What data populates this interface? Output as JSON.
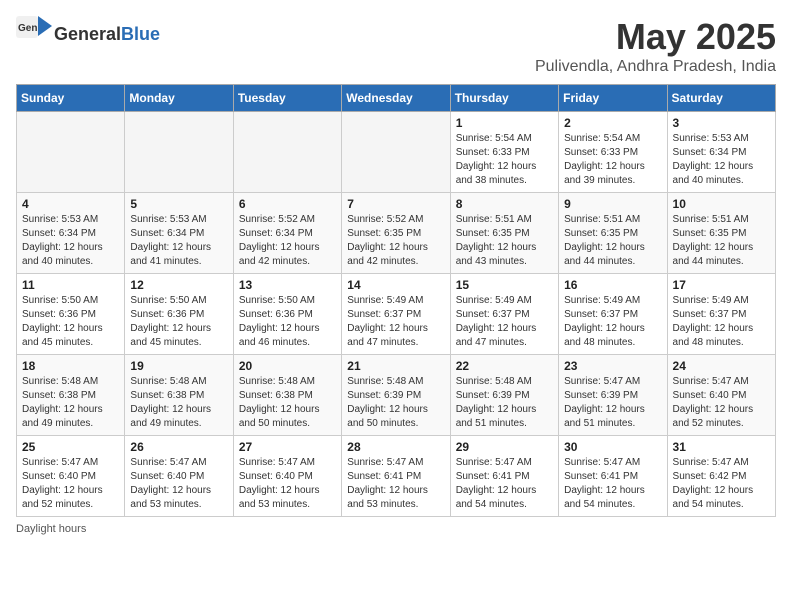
{
  "header": {
    "logo_general": "General",
    "logo_blue": "Blue",
    "title": "May 2025",
    "location": "Pulivendla, Andhra Pradesh, India"
  },
  "days_of_week": [
    "Sunday",
    "Monday",
    "Tuesday",
    "Wednesday",
    "Thursday",
    "Friday",
    "Saturday"
  ],
  "note": "Daylight hours",
  "weeks": [
    [
      {
        "day": "",
        "empty": true
      },
      {
        "day": "",
        "empty": true
      },
      {
        "day": "",
        "empty": true
      },
      {
        "day": "",
        "empty": true
      },
      {
        "day": "1",
        "sunrise": "Sunrise: 5:54 AM",
        "sunset": "Sunset: 6:33 PM",
        "daylight": "Daylight: 12 hours and 38 minutes."
      },
      {
        "day": "2",
        "sunrise": "Sunrise: 5:54 AM",
        "sunset": "Sunset: 6:33 PM",
        "daylight": "Daylight: 12 hours and 39 minutes."
      },
      {
        "day": "3",
        "sunrise": "Sunrise: 5:53 AM",
        "sunset": "Sunset: 6:34 PM",
        "daylight": "Daylight: 12 hours and 40 minutes."
      }
    ],
    [
      {
        "day": "4",
        "sunrise": "Sunrise: 5:53 AM",
        "sunset": "Sunset: 6:34 PM",
        "daylight": "Daylight: 12 hours and 40 minutes."
      },
      {
        "day": "5",
        "sunrise": "Sunrise: 5:53 AM",
        "sunset": "Sunset: 6:34 PM",
        "daylight": "Daylight: 12 hours and 41 minutes."
      },
      {
        "day": "6",
        "sunrise": "Sunrise: 5:52 AM",
        "sunset": "Sunset: 6:34 PM",
        "daylight": "Daylight: 12 hours and 42 minutes."
      },
      {
        "day": "7",
        "sunrise": "Sunrise: 5:52 AM",
        "sunset": "Sunset: 6:35 PM",
        "daylight": "Daylight: 12 hours and 42 minutes."
      },
      {
        "day": "8",
        "sunrise": "Sunrise: 5:51 AM",
        "sunset": "Sunset: 6:35 PM",
        "daylight": "Daylight: 12 hours and 43 minutes."
      },
      {
        "day": "9",
        "sunrise": "Sunrise: 5:51 AM",
        "sunset": "Sunset: 6:35 PM",
        "daylight": "Daylight: 12 hours and 44 minutes."
      },
      {
        "day": "10",
        "sunrise": "Sunrise: 5:51 AM",
        "sunset": "Sunset: 6:35 PM",
        "daylight": "Daylight: 12 hours and 44 minutes."
      }
    ],
    [
      {
        "day": "11",
        "sunrise": "Sunrise: 5:50 AM",
        "sunset": "Sunset: 6:36 PM",
        "daylight": "Daylight: 12 hours and 45 minutes."
      },
      {
        "day": "12",
        "sunrise": "Sunrise: 5:50 AM",
        "sunset": "Sunset: 6:36 PM",
        "daylight": "Daylight: 12 hours and 45 minutes."
      },
      {
        "day": "13",
        "sunrise": "Sunrise: 5:50 AM",
        "sunset": "Sunset: 6:36 PM",
        "daylight": "Daylight: 12 hours and 46 minutes."
      },
      {
        "day": "14",
        "sunrise": "Sunrise: 5:49 AM",
        "sunset": "Sunset: 6:37 PM",
        "daylight": "Daylight: 12 hours and 47 minutes."
      },
      {
        "day": "15",
        "sunrise": "Sunrise: 5:49 AM",
        "sunset": "Sunset: 6:37 PM",
        "daylight": "Daylight: 12 hours and 47 minutes."
      },
      {
        "day": "16",
        "sunrise": "Sunrise: 5:49 AM",
        "sunset": "Sunset: 6:37 PM",
        "daylight": "Daylight: 12 hours and 48 minutes."
      },
      {
        "day": "17",
        "sunrise": "Sunrise: 5:49 AM",
        "sunset": "Sunset: 6:37 PM",
        "daylight": "Daylight: 12 hours and 48 minutes."
      }
    ],
    [
      {
        "day": "18",
        "sunrise": "Sunrise: 5:48 AM",
        "sunset": "Sunset: 6:38 PM",
        "daylight": "Daylight: 12 hours and 49 minutes."
      },
      {
        "day": "19",
        "sunrise": "Sunrise: 5:48 AM",
        "sunset": "Sunset: 6:38 PM",
        "daylight": "Daylight: 12 hours and 49 minutes."
      },
      {
        "day": "20",
        "sunrise": "Sunrise: 5:48 AM",
        "sunset": "Sunset: 6:38 PM",
        "daylight": "Daylight: 12 hours and 50 minutes."
      },
      {
        "day": "21",
        "sunrise": "Sunrise: 5:48 AM",
        "sunset": "Sunset: 6:39 PM",
        "daylight": "Daylight: 12 hours and 50 minutes."
      },
      {
        "day": "22",
        "sunrise": "Sunrise: 5:48 AM",
        "sunset": "Sunset: 6:39 PM",
        "daylight": "Daylight: 12 hours and 51 minutes."
      },
      {
        "day": "23",
        "sunrise": "Sunrise: 5:47 AM",
        "sunset": "Sunset: 6:39 PM",
        "daylight": "Daylight: 12 hours and 51 minutes."
      },
      {
        "day": "24",
        "sunrise": "Sunrise: 5:47 AM",
        "sunset": "Sunset: 6:40 PM",
        "daylight": "Daylight: 12 hours and 52 minutes."
      }
    ],
    [
      {
        "day": "25",
        "sunrise": "Sunrise: 5:47 AM",
        "sunset": "Sunset: 6:40 PM",
        "daylight": "Daylight: 12 hours and 52 minutes."
      },
      {
        "day": "26",
        "sunrise": "Sunrise: 5:47 AM",
        "sunset": "Sunset: 6:40 PM",
        "daylight": "Daylight: 12 hours and 53 minutes."
      },
      {
        "day": "27",
        "sunrise": "Sunrise: 5:47 AM",
        "sunset": "Sunset: 6:40 PM",
        "daylight": "Daylight: 12 hours and 53 minutes."
      },
      {
        "day": "28",
        "sunrise": "Sunrise: 5:47 AM",
        "sunset": "Sunset: 6:41 PM",
        "daylight": "Daylight: 12 hours and 53 minutes."
      },
      {
        "day": "29",
        "sunrise": "Sunrise: 5:47 AM",
        "sunset": "Sunset: 6:41 PM",
        "daylight": "Daylight: 12 hours and 54 minutes."
      },
      {
        "day": "30",
        "sunrise": "Sunrise: 5:47 AM",
        "sunset": "Sunset: 6:41 PM",
        "daylight": "Daylight: 12 hours and 54 minutes."
      },
      {
        "day": "31",
        "sunrise": "Sunrise: 5:47 AM",
        "sunset": "Sunset: 6:42 PM",
        "daylight": "Daylight: 12 hours and 54 minutes."
      }
    ]
  ]
}
